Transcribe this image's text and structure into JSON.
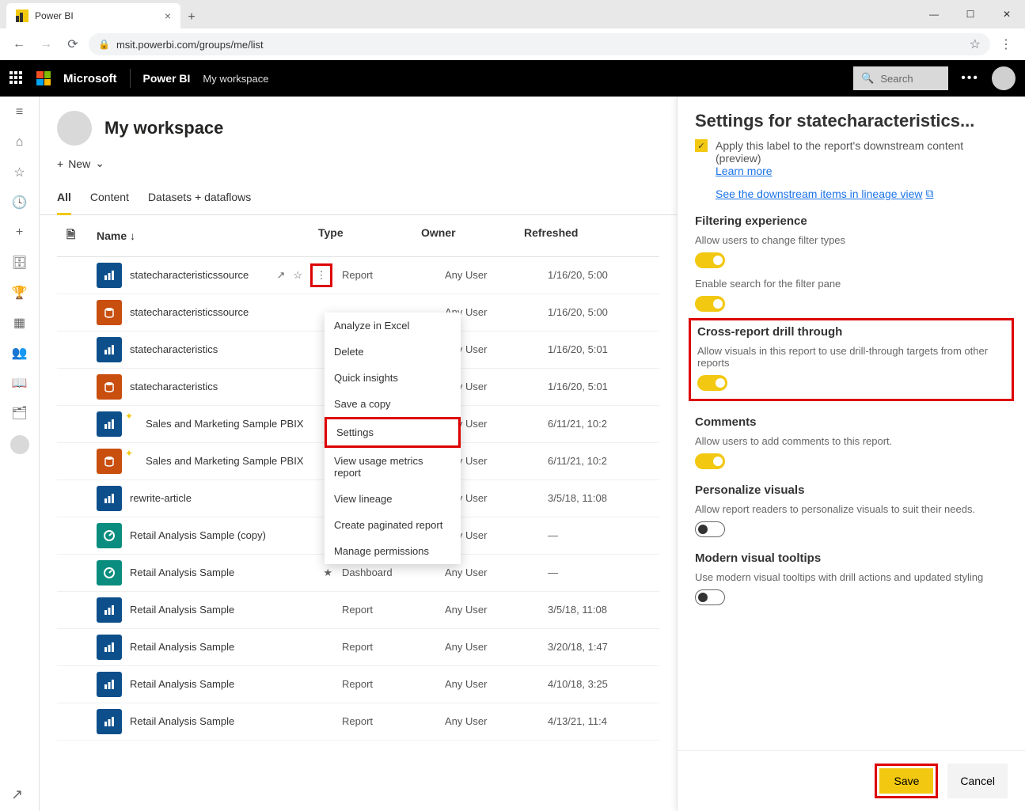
{
  "browser": {
    "tab_title": "Power BI",
    "url": "msit.powerbi.com/groups/me/list"
  },
  "topbar": {
    "brand": "Microsoft",
    "product": "Power BI",
    "workspace": "My workspace",
    "search_placeholder": "Search"
  },
  "workspace": {
    "title": "My workspace",
    "new_label": "New"
  },
  "tabs": {
    "all": "All",
    "content": "Content",
    "datasets": "Datasets + dataflows"
  },
  "columns": {
    "name": "Name",
    "type": "Type",
    "owner": "Owner",
    "refreshed": "Refreshed"
  },
  "rows": [
    {
      "name": "statecharacteristicssource",
      "type": "Report",
      "owner": "Any User",
      "refreshed": "1/16/20, 5:00",
      "icon": "report",
      "actions": true
    },
    {
      "name": "statecharacteristicssource",
      "type": "",
      "owner": "Any User",
      "refreshed": "1/16/20, 5:00",
      "icon": "dataset"
    },
    {
      "name": "statecharacteristics",
      "type": "",
      "owner": "Any User",
      "refreshed": "1/16/20, 5:01",
      "icon": "report"
    },
    {
      "name": "statecharacteristics",
      "type": "",
      "owner": "Any User",
      "refreshed": "1/16/20, 5:01",
      "icon": "dataset"
    },
    {
      "name": "Sales and Marketing Sample PBIX",
      "type": "",
      "owner": "Any User",
      "refreshed": "6/11/21, 10:2",
      "icon": "report",
      "sparkle": true
    },
    {
      "name": "Sales and Marketing Sample PBIX",
      "type": "",
      "owner": "Any User",
      "refreshed": "6/11/21, 10:2",
      "icon": "dataset",
      "sparkle": true
    },
    {
      "name": "rewrite-article",
      "type": "",
      "owner": "Any User",
      "refreshed": "3/5/18, 11:08",
      "icon": "report"
    },
    {
      "name": "Retail Analysis Sample (copy)",
      "type": "",
      "owner": "Any User",
      "refreshed": "—",
      "icon": "dashboard"
    },
    {
      "name": "Retail Analysis Sample",
      "type": "Dashboard",
      "owner": "Any User",
      "refreshed": "—",
      "icon": "dashboard",
      "starred": true
    },
    {
      "name": "Retail Analysis Sample",
      "type": "Report",
      "owner": "Any User",
      "refreshed": "3/5/18, 11:08",
      "icon": "report"
    },
    {
      "name": "Retail Analysis Sample",
      "type": "Report",
      "owner": "Any User",
      "refreshed": "3/20/18, 1:47",
      "icon": "report"
    },
    {
      "name": "Retail Analysis Sample",
      "type": "Report",
      "owner": "Any User",
      "refreshed": "4/10/18, 3:25",
      "icon": "report"
    },
    {
      "name": "Retail Analysis Sample",
      "type": "Report",
      "owner": "Any User",
      "refreshed": "4/13/21, 11:4",
      "icon": "report"
    }
  ],
  "context_menu": {
    "items": [
      "Analyze in Excel",
      "Delete",
      "Quick insights",
      "Save a copy",
      "Settings",
      "View usage metrics report",
      "View lineage",
      "Create paginated report",
      "Manage permissions"
    ]
  },
  "settings": {
    "title": "Settings for statecharacteristics...",
    "apply_label": "Apply this label to the report's downstream content (preview)",
    "learn_more": "Learn more",
    "lineage_link": "See the downstream items in lineage view",
    "filter_title": "Filtering experience",
    "filter_desc1": "Allow users to change filter types",
    "filter_desc2": "Enable search for the filter pane",
    "crossreport_title": "Cross-report drill through",
    "crossreport_desc": "Allow visuals in this report to use drill-through targets from other reports",
    "comments_title": "Comments",
    "comments_desc": "Allow users to add comments to this report.",
    "personalize_title": "Personalize visuals",
    "personalize_desc": "Allow report readers to personalize visuals to suit their needs.",
    "tooltips_title": "Modern visual tooltips",
    "tooltips_desc": "Use modern visual tooltips with drill actions and updated styling",
    "save": "Save",
    "cancel": "Cancel"
  }
}
